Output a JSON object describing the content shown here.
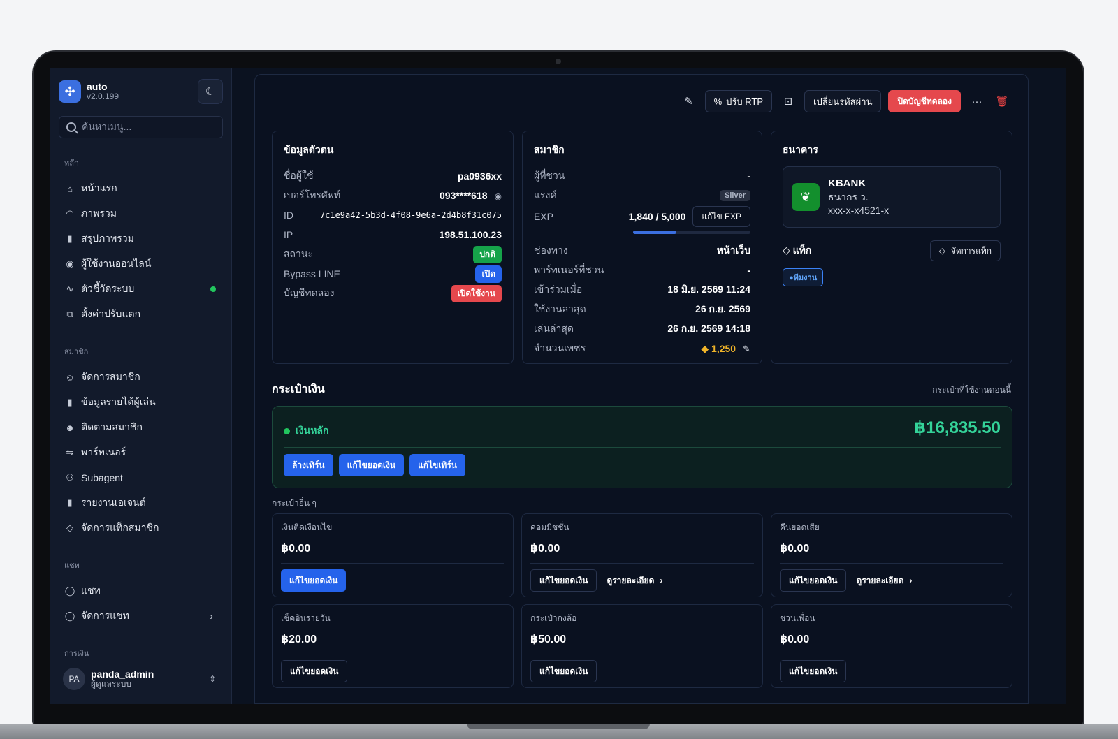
{
  "sidebar": {
    "brand_name": "auto",
    "brand_version": "v2.0.199",
    "search_placeholder": "ค้นหาเมนู...",
    "sections": [
      {
        "label": "หลัก",
        "items": [
          "หน้าแรก",
          "ภาพรวม",
          "สรุปภาพรวม",
          "ผู้ใช้งานออนไลน์",
          "ตัวชี้วัดระบบ",
          "ตั้งค่าปรับแตก"
        ]
      },
      {
        "label": "สมาชิก",
        "items": [
          "จัดการสมาชิก",
          "ข้อมูลรายได้ผู้เล่น",
          "ติดตามสมาชิก",
          "พาร์ทเนอร์",
          "Subagent",
          "รายงานเอเจนต์",
          "จัดการแท็กสมาชิก"
        ]
      },
      {
        "label": "แชท",
        "items": [
          "แชท",
          "จัดการแชท"
        ]
      },
      {
        "label": "การเงิน",
        "items": []
      }
    ],
    "user": {
      "initials": "PA",
      "name": "panda_admin",
      "role": "ผู้ดูแลระบบ"
    }
  },
  "toolbar": {
    "rtp_label": "ปรับ RTP",
    "change_password": "เปลี่ยนรหัสผ่าน",
    "close_trial": "ปิดบัญชีทดลอง"
  },
  "profile": {
    "title": "ข้อมูลตัวตน",
    "rows": [
      {
        "k": "ชื่อผู้ใช้",
        "v": "pa0936xx"
      },
      {
        "k": "เบอร์โทรศัพท์",
        "v": "093****618"
      },
      {
        "k": "ID",
        "v": "7c1e9a42-5b3d-4f08-9e6a-2d4b8f31c075"
      },
      {
        "k": "IP",
        "v": "198.51.100.23"
      }
    ],
    "status_label": "สถานะ",
    "status_value": "ปกติ",
    "bypass_label": "Bypass LINE",
    "bypass_value": "เปิด",
    "trial_label": "บัญชีทดลอง",
    "trial_value": "เปิดใช้งาน"
  },
  "member": {
    "title": "สมาชิก",
    "referrer_label": "ผู้ที่ชวน",
    "referrer_value": "-",
    "rank_label": "แรงค์",
    "rank_value": "Silver",
    "exp_label": "EXP",
    "exp_value": "1,840 / 5,000",
    "exp_fraction": 0.368,
    "exp_btn": "แก้ไข EXP",
    "rows": [
      {
        "k": "ช่องทาง",
        "v": "หน้าเว็บ"
      },
      {
        "k": "พาร์ทเนอร์ที่ชวน",
        "v": "-"
      },
      {
        "k": "เข้าร่วมเมื่อ",
        "v": "18 มิ.ย. 2569 11:24"
      },
      {
        "k": "ใช้งานล่าสุด",
        "v": "26 ก.ย. 2569"
      },
      {
        "k": "เล่นล่าสุด",
        "v": "26 ก.ย. 2569 14:18"
      }
    ],
    "diamond_label": "จำนวนเพชร",
    "diamond_value": "1,250"
  },
  "bank": {
    "title": "ธนาคาร",
    "name": "KBANK",
    "owner": "ธนากร ว.",
    "account": "xxx-x-x4521-x",
    "tag_label": "แท็ก",
    "tag_btn": "จัดการแท็ก",
    "tag_chip": "●ทีมงาน"
  },
  "wallet": {
    "title": "กระเป๋าเงิน",
    "subtitle": "กระเป๋าที่ใช้งานตอนนี้",
    "main_label": "เงินหลัก",
    "main_amount": "฿16,835.50",
    "main_btns": [
      "ล้างเทิร์น",
      "แก้ไขยอดเงิน",
      "แก้ไขเทิร์น"
    ],
    "others_label": "กระเป๋าอื่น ๆ",
    "others": [
      {
        "title": "เงินติดเงื่อนไข",
        "amount": "฿0.00",
        "btn": "แก้ไขยอดเงิน",
        "detail": ""
      },
      {
        "title": "คอมมิชชั่น",
        "amount": "฿0.00",
        "btn": "แก้ไขยอดเงิน",
        "detail": "ดูรายละเอียด"
      },
      {
        "title": "คืนยอดเสีย",
        "amount": "฿0.00",
        "btn": "แก้ไขยอดเงิน",
        "detail": "ดูรายละเอียด"
      },
      {
        "title": "เช็คอินรายวัน",
        "amount": "฿20.00",
        "btn": "แก้ไขยอดเงิน",
        "detail": ""
      },
      {
        "title": "กระเป๋ากงล้อ",
        "amount": "฿50.00",
        "btn": "แก้ไขยอดเงิน",
        "detail": ""
      },
      {
        "title": "ชวนเพื่อน",
        "amount": "฿0.00",
        "btn": "แก้ไขยอดเงิน",
        "detail": ""
      }
    ]
  },
  "colors": {
    "accent": "#2563eb",
    "danger": "#e5484d",
    "success": "#34d399"
  }
}
